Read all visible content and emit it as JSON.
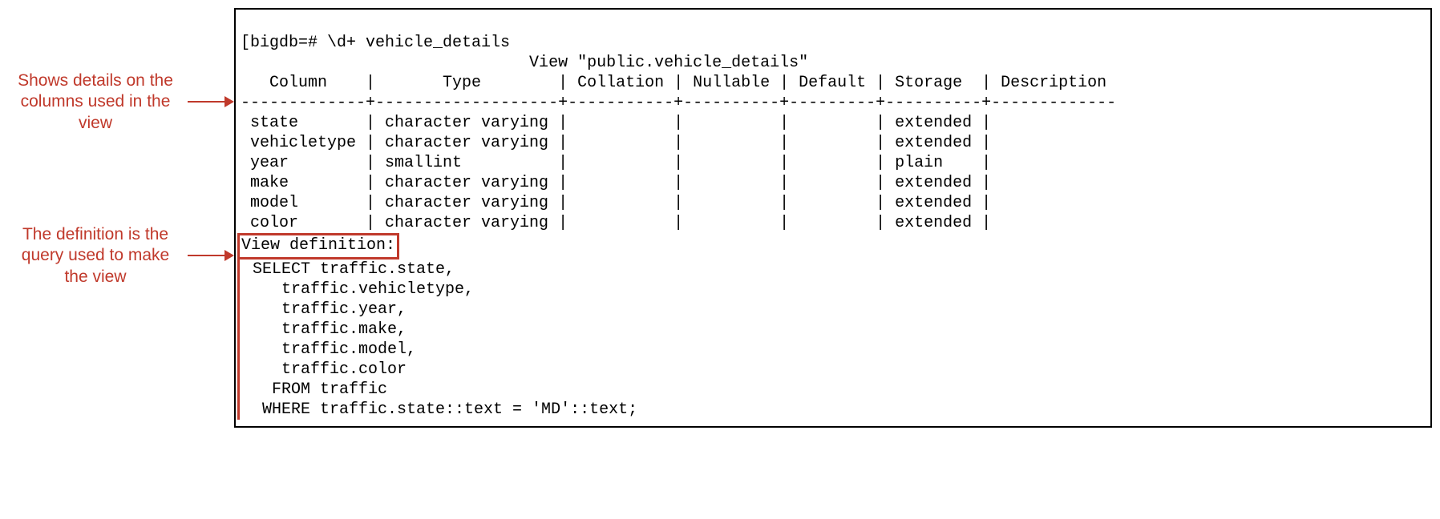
{
  "annotations": {
    "columns_note": "Shows details\non the\ncolumns used\nin the view",
    "definition_note": "The definition is\nthe query used\nto make the view"
  },
  "terminal": {
    "prompt_line": "[bigdb=# \\d+ vehicle_details",
    "view_title_line": "                              View \"public.vehicle_details\"",
    "header_line": "   Column    |       Type        | Collation | Nullable | Default | Storage  | Description",
    "separator_line": "-------------+-------------------+-----------+----------+---------+----------+-------------",
    "rows": [
      " state       | character varying |           |          |         | extended |",
      " vehicletype | character varying |           |          |         | extended |",
      " year        | smallint          |           |          |         | plain    |",
      " make        | character varying |           |          |         | extended |",
      " model       | character varying |           |          |         | extended |",
      " color       | character varying |           |          |         | extended |"
    ],
    "view_def_label": "View definition:",
    "view_def_lines": [
      " SELECT traffic.state,",
      "    traffic.vehicletype,",
      "    traffic.year,",
      "    traffic.make,",
      "    traffic.model,",
      "    traffic.color",
      "   FROM traffic",
      "  WHERE traffic.state::text = 'MD'::text;"
    ]
  },
  "chart_data": {
    "type": "table",
    "title": "View \"public.vehicle_details\"",
    "columns": [
      "Column",
      "Type",
      "Collation",
      "Nullable",
      "Default",
      "Storage",
      "Description"
    ],
    "rows": [
      {
        "Column": "state",
        "Type": "character varying",
        "Collation": "",
        "Nullable": "",
        "Default": "",
        "Storage": "extended",
        "Description": ""
      },
      {
        "Column": "vehicletype",
        "Type": "character varying",
        "Collation": "",
        "Nullable": "",
        "Default": "",
        "Storage": "extended",
        "Description": ""
      },
      {
        "Column": "year",
        "Type": "smallint",
        "Collation": "",
        "Nullable": "",
        "Default": "",
        "Storage": "plain",
        "Description": ""
      },
      {
        "Column": "make",
        "Type": "character varying",
        "Collation": "",
        "Nullable": "",
        "Default": "",
        "Storage": "extended",
        "Description": ""
      },
      {
        "Column": "model",
        "Type": "character varying",
        "Collation": "",
        "Nullable": "",
        "Default": "",
        "Storage": "extended",
        "Description": ""
      },
      {
        "Column": "color",
        "Type": "character varying",
        "Collation": "",
        "Nullable": "",
        "Default": "",
        "Storage": "extended",
        "Description": ""
      }
    ],
    "view_definition": "SELECT traffic.state, traffic.vehicletype, traffic.year, traffic.make, traffic.model, traffic.color FROM traffic WHERE traffic.state::text = 'MD'::text;"
  }
}
